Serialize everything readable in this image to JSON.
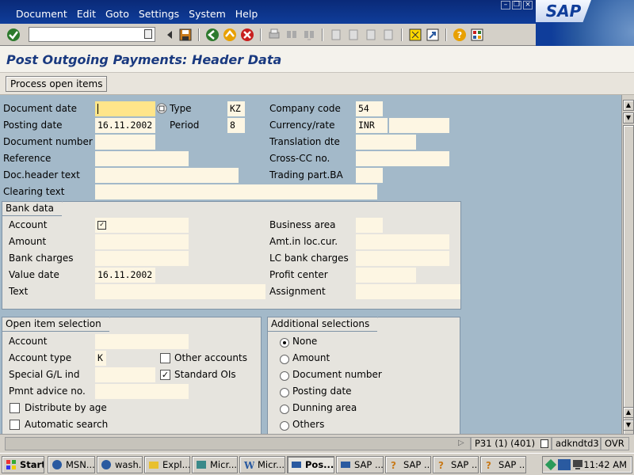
{
  "menu": [
    "Document",
    "Edit",
    "Goto",
    "Settings",
    "System",
    "Help"
  ],
  "logo_text": "SAP",
  "screen_title": "Post Outgoing Payments: Header Data",
  "app_button": "Process open items",
  "header": {
    "document_date_label": "Document date",
    "type_label": "Type",
    "type_value": "KZ",
    "company_code_label": "Company code",
    "company_code_value": "54",
    "posting_date_label": "Posting date",
    "posting_date_value": "16.11.2002",
    "period_label": "Period",
    "period_value": "8",
    "currency_label": "Currency/rate",
    "currency_value": "INR",
    "document_number_label": "Document number",
    "translation_label": "Translation dte",
    "reference_label": "Reference",
    "cross_cc_label": "Cross-CC no.",
    "doc_header_text_label": "Doc.header text",
    "trading_part_label": "Trading part.BA",
    "clearing_text_label": "Clearing text"
  },
  "bank_data": {
    "title": "Bank data",
    "account_label": "Account",
    "business_area_label": "Business area",
    "amount_label": "Amount",
    "amt_loc_label": "Amt.in loc.cur.",
    "bank_charges_label": "Bank charges",
    "lc_bank_charges_label": "LC bank charges",
    "value_date_label": "Value date",
    "value_date_value": "16.11.2002",
    "profit_center_label": "Profit center",
    "text_label": "Text",
    "assignment_label": "Assignment"
  },
  "open_item": {
    "title": "Open item selection",
    "account_label": "Account",
    "account_type_label": "Account type",
    "account_type_value": "K",
    "other_accounts_label": "Other accounts",
    "special_gl_label": "Special G/L ind",
    "standard_ois_label": "Standard OIs",
    "standard_ois_checked": true,
    "pmnt_advice_label": "Pmnt advice no.",
    "distribute_label": "Distribute by age",
    "automatic_label": "Automatic search"
  },
  "additional": {
    "title": "Additional selections",
    "options": [
      "None",
      "Amount",
      "Document number",
      "Posting date",
      "Dunning area",
      "Others"
    ],
    "selected": "None"
  },
  "status": {
    "session": "P31 (1) (401)",
    "server": "adkndtd3",
    "mode": "OVR"
  },
  "taskbar": {
    "start": "Start",
    "items": [
      "MSN...",
      "wash...",
      "Expl...",
      "Micr...",
      "Micr...",
      "Pos...",
      "SAP ...",
      "SAP ...",
      "SAP ...",
      "SAP ..."
    ],
    "clock": "11:42 AM"
  },
  "colors": {
    "menubar": "#0f3d9a",
    "title_text": "#1a3a80",
    "background": "#a3b9c9",
    "input_fill": "#fdf6e3"
  }
}
